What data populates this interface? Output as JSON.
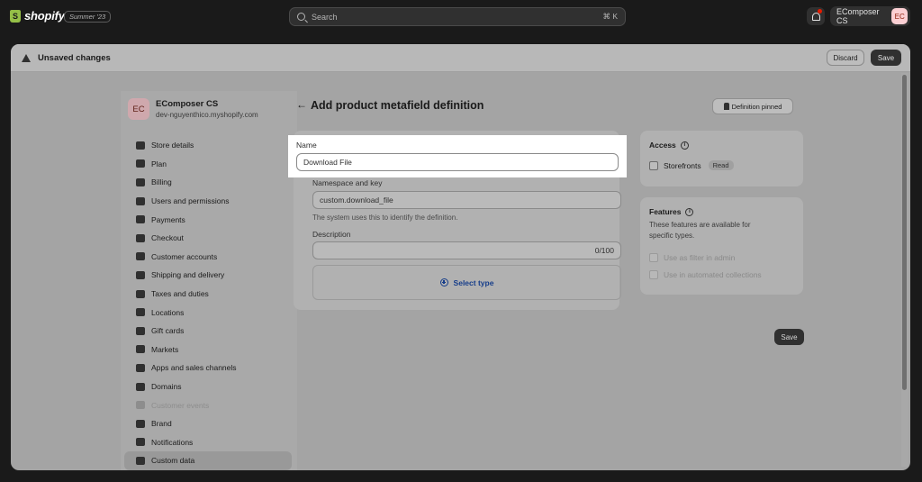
{
  "topbar": {
    "logo_text": "shopify",
    "edition": "Summer '23",
    "search_placeholder": "Search",
    "search_shortcut": "⌘ K",
    "account_name": "EComposer CS",
    "account_initials": "EC"
  },
  "unsaved_bar": {
    "title": "Unsaved changes",
    "discard_label": "Discard",
    "save_label": "Save"
  },
  "sidebar": {
    "store_initials": "EC",
    "store_name": "EComposer CS",
    "store_domain": "dev-nguyenthico.myshopify.com",
    "items": [
      {
        "label": "Store details",
        "icon": "store-icon"
      },
      {
        "label": "Plan",
        "icon": "plan-icon"
      },
      {
        "label": "Billing",
        "icon": "billing-icon"
      },
      {
        "label": "Users and permissions",
        "icon": "users-icon"
      },
      {
        "label": "Payments",
        "icon": "payments-icon"
      },
      {
        "label": "Checkout",
        "icon": "cart-icon"
      },
      {
        "label": "Customer accounts",
        "icon": "person-icon"
      },
      {
        "label": "Shipping and delivery",
        "icon": "truck-icon"
      },
      {
        "label": "Taxes and duties",
        "icon": "taxes-icon"
      },
      {
        "label": "Locations",
        "icon": "location-icon"
      },
      {
        "label": "Gift cards",
        "icon": "gift-card-icon"
      },
      {
        "label": "Markets",
        "icon": "globe-icon"
      },
      {
        "label": "Apps and sales channels",
        "icon": "apps-icon"
      },
      {
        "label": "Domains",
        "icon": "globe-icon"
      },
      {
        "label": "Customer events",
        "icon": "events-icon",
        "disabled": true
      },
      {
        "label": "Brand",
        "icon": "brand-icon"
      },
      {
        "label": "Notifications",
        "icon": "bell-icon"
      },
      {
        "label": "Custom data",
        "icon": "database-icon",
        "active": true
      }
    ]
  },
  "main": {
    "title": "Add product metafield definition",
    "pinned_label": "Definition pinned",
    "name_label": "Name",
    "name_value": "Download File",
    "namespace_label": "Namespace and key",
    "namespace_value": "custom.download_file",
    "namespace_help": "The system uses this to identify the definition.",
    "description_label": "Description",
    "description_counter": "0/100",
    "select_type_label": "Select type",
    "save_label": "Save"
  },
  "access": {
    "title": "Access",
    "storefronts_label": "Storefronts",
    "storefronts_badge": "Read"
  },
  "features": {
    "title": "Features",
    "description": "These features are available for specific types.",
    "options": [
      "Use as filter in admin",
      "Use in automated collections"
    ]
  }
}
